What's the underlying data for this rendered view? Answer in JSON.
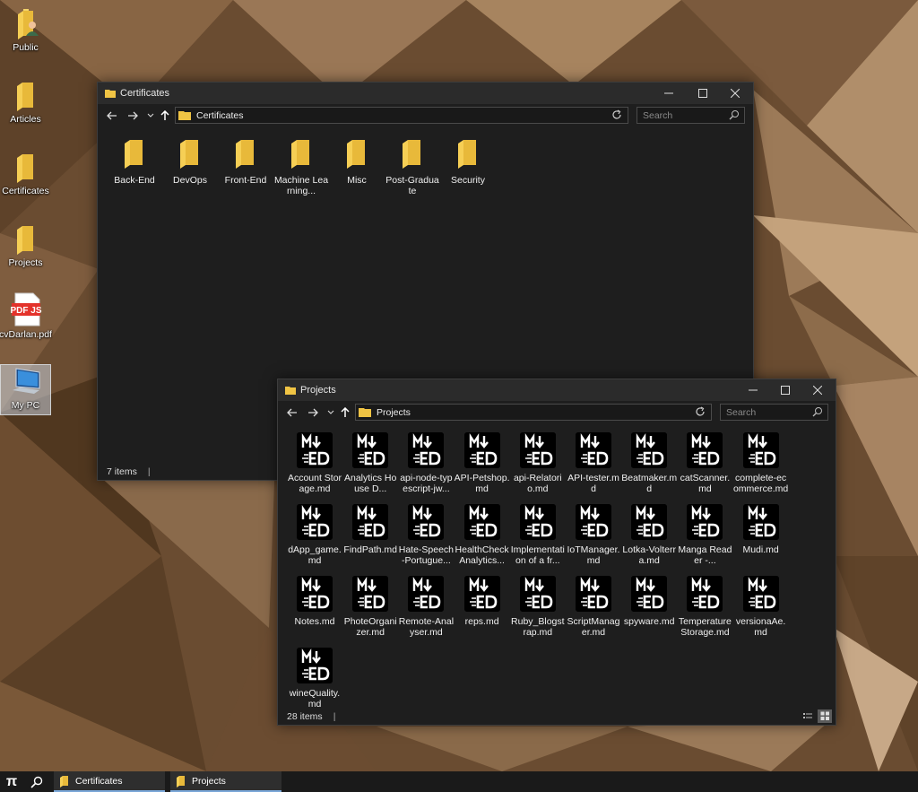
{
  "desktop": {
    "icons": [
      {
        "label": "Public",
        "icon": "user-folder-icon"
      },
      {
        "label": "Articles",
        "icon": "folder-icon"
      },
      {
        "label": "Certificates",
        "icon": "folder-icon"
      },
      {
        "label": "Projects",
        "icon": "folder-icon"
      },
      {
        "label": "cvDarlan.pdf",
        "icon": "pdf-js-icon",
        "badge": "PDF JS"
      },
      {
        "label": "My PC",
        "icon": "computer-icon"
      }
    ]
  },
  "certificates_window": {
    "title": "Certificates",
    "address": "Certificates",
    "search_placeholder": "Search",
    "items": [
      "Back-End",
      "DevOps",
      "Front-End",
      "Machine Learning...",
      "Misc",
      "Post-Graduate",
      "Security"
    ],
    "status": "7 items",
    "status_sep": "|"
  },
  "projects_window": {
    "title": "Projects",
    "address": "Projects",
    "search_placeholder": "Search",
    "items": [
      "Account Storage.md",
      "Analytics House D...",
      "api-node-typescript-jw...",
      "API-Petshop.md",
      "api-Relatorio.md",
      "API-tester.md",
      "Beatmaker.md",
      "catScanner.md",
      "complete-ecommerce.md",
      "dApp_game.md",
      "FindPath.md",
      "Hate-Speech-Portugue...",
      "HealthCheck Analytics...",
      "Implementation of a fr...",
      "IoTManager.md",
      "Lotka-Volterra.md",
      "Manga Reader -...",
      "Mudi.md",
      "Notes.md",
      "PhoteOrganizer.md",
      "Remote-Analyser.md",
      "reps.md",
      "Ruby_Blogstrap.md",
      "ScriptManager.md",
      "spyware.md",
      "Temperature Storage.md",
      "versionaAe.md",
      "wineQuality.md"
    ],
    "status": "28 items",
    "status_sep": "|"
  },
  "taskbar": {
    "start_glyph": "π",
    "tasks": [
      "Certificates",
      "Projects"
    ]
  },
  "colors": {
    "folder": "#f0c444",
    "window_bg": "#1e1e1e",
    "titlebar_bg": "#2b2b2b",
    "taskbar_bg": "#1a1a1a"
  }
}
